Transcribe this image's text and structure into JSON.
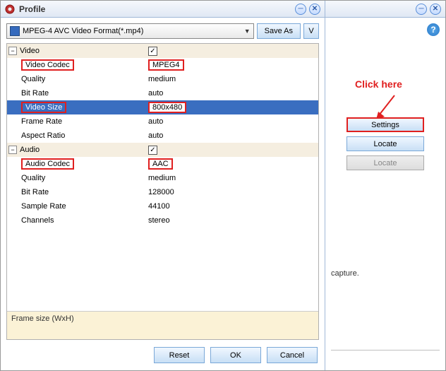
{
  "left": {
    "title": "Profile",
    "format": "MPEG-4 AVC Video Format(*.mp4)",
    "saveAs": "Save As",
    "vBtn": "V",
    "groups": {
      "video": {
        "label": "Video",
        "checked": "✓",
        "rows": {
          "codec": {
            "label": "Video Codec",
            "value": "MPEG4"
          },
          "quality": {
            "label": "Quality",
            "value": "medium"
          },
          "bitrate": {
            "label": "Bit Rate",
            "value": "auto"
          },
          "size": {
            "label": "Video Size",
            "value": "800x480"
          },
          "framerate": {
            "label": "Frame Rate",
            "value": "auto"
          },
          "aspect": {
            "label": "Aspect Ratio",
            "value": "auto"
          }
        }
      },
      "audio": {
        "label": "Audio",
        "checked": "✓",
        "rows": {
          "codec": {
            "label": "Audio Codec",
            "value": "AAC"
          },
          "quality": {
            "label": "Quality",
            "value": "medium"
          },
          "bitrate": {
            "label": "Bit Rate",
            "value": "128000"
          },
          "samplerate": {
            "label": "Sample Rate",
            "value": "44100"
          },
          "channels": {
            "label": "Channels",
            "value": "stereo"
          }
        }
      }
    },
    "hint": "Frame size (WxH)",
    "buttons": {
      "reset": "Reset",
      "ok": "OK",
      "cancel": "Cancel"
    }
  },
  "right": {
    "instruction": "Click here",
    "buttons": {
      "settings": "Settings",
      "locate": "Locate",
      "locate2": "Locate"
    },
    "caption": "capture."
  }
}
